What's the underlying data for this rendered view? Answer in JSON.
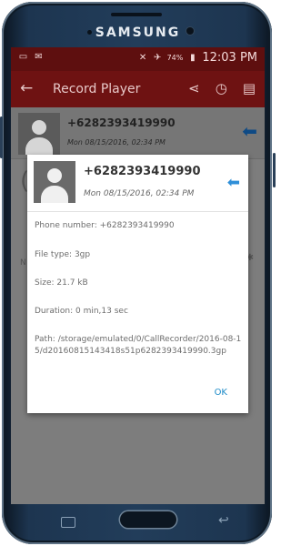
{
  "device": {
    "brand": "SAMSUNG"
  },
  "status_bar": {
    "battery": "74%",
    "time": "12:03 PM"
  },
  "app_bar": {
    "title": "Record Player"
  },
  "list": {
    "number": "+6282393419990",
    "date": "Mon 08/15/2016, 02:34 PM"
  },
  "dialog": {
    "number": "+6282393419990",
    "date": "Mon 08/15/2016, 02:34 PM",
    "phone_number_label": "Phone number:",
    "phone_number_value": "+6282393419990",
    "file_type_label": "File type:",
    "file_type_value": "3gp",
    "size_label": "Size:",
    "size_value": "21.7 kB",
    "duration_label": "Duration:",
    "duration_value": "0 min,13 sec",
    "path_label": "Path:",
    "path_value": "/storage/emulated/0/CallRecorder/2016-08-15/d20160815143418s51p6282393419990.3gp",
    "ok_label": "OK"
  },
  "colors": {
    "status_bar": "#5e0f0f",
    "app_bar": "#6e1212",
    "accent": "#1f8cc8",
    "arrow_blue": "#2f8fd8"
  }
}
